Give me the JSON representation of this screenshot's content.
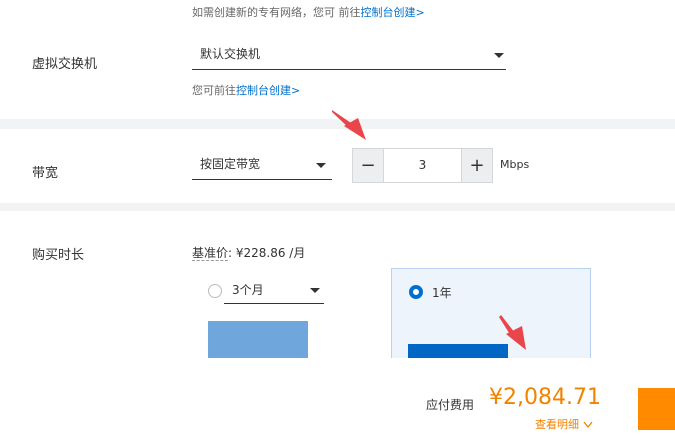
{
  "network": {
    "hint_prefix": "如需创建新的专有网络，您可 前往",
    "hint_link": "控制台创建>"
  },
  "vswitch": {
    "label": "虚拟交换机",
    "selected": "默认交换机",
    "hint_prefix": "您可前往",
    "hint_link": "控制台创建>"
  },
  "bandwidth": {
    "label": "带宽",
    "mode_selected": "按固定带宽",
    "minus_label": "−",
    "value": "3",
    "plus_label": "+",
    "unit": "Mbps"
  },
  "duration": {
    "label": "购买时长",
    "base_price_label": "基准价",
    "base_price_value": ": ¥228.86 /月",
    "option_months_selected": "3个月",
    "option_year_label": "1年",
    "selected_option": "1年"
  },
  "footer": {
    "fee_label": "应付费用",
    "fee_amount": "¥2,084.71",
    "details_link": "查看明细"
  },
  "colors": {
    "accent_blue": "#0070cc",
    "price_orange": "#f08300",
    "buy_orange": "#ff8a00",
    "annotation_red": "#e8464b",
    "bar_light": "#6fa6dc",
    "bar_dark": "#0068c4"
  },
  "icons": {
    "dropdown": "caret-down-icon",
    "arrow": "red-pointer-arrow-icon",
    "details": "chevron-down-icon"
  }
}
